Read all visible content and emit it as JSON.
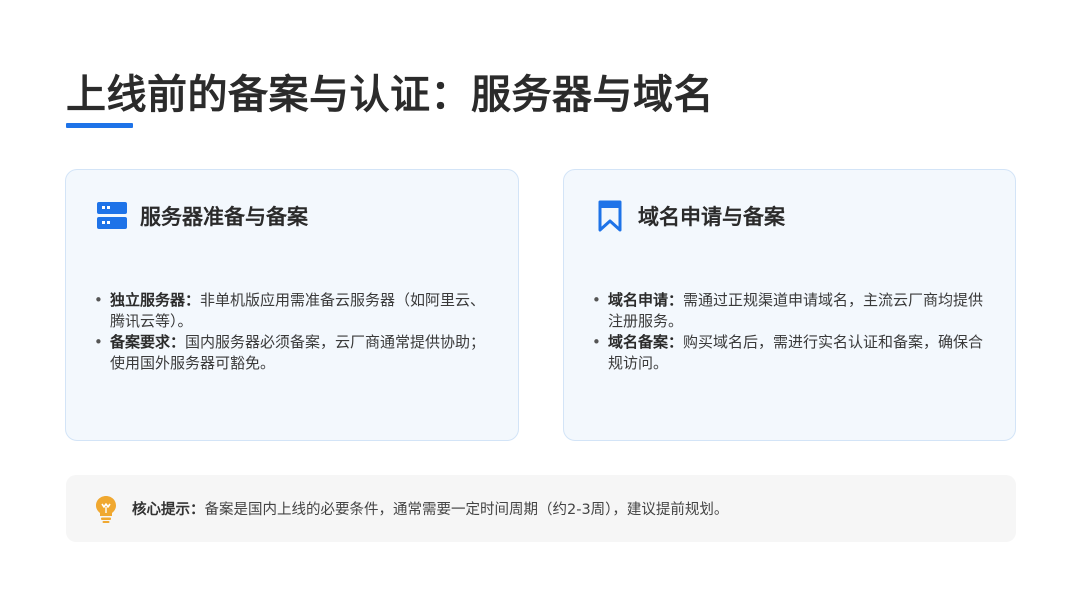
{
  "slide": {
    "title": "上线前的备案与认证：服务器与域名"
  },
  "cards": [
    {
      "icon": "server-icon",
      "title": "服务器准备与备案",
      "items": [
        {
          "key": "独立服务器：",
          "text": "非单机版应用需准备云服务器（如阿里云、腾讯云等）。"
        },
        {
          "key": "备案要求：",
          "text": "国内服务器必须备案，云厂商通常提供协助；使用国外服务器可豁免。"
        }
      ]
    },
    {
      "icon": "bookmark-icon",
      "title": "域名申请与备案",
      "items": [
        {
          "key": "域名申请：",
          "text": "需通过正规渠道申请域名，主流云厂商均提供注册服务。"
        },
        {
          "key": "域名备案：",
          "text": "购买域名后，需进行实名认证和备案，确保合规访问。"
        }
      ]
    }
  ],
  "tip": {
    "icon": "lightbulb-icon",
    "key": "核心提示：",
    "text": "备案是国内上线的必要条件，通常需要一定时间周期（约2-3周），建议提前规划。"
  },
  "colors": {
    "accent": "#1e73e8",
    "card_bg": "#f3f8fd",
    "card_border": "#d3e4f7",
    "tip_bg": "#f6f6f6",
    "tip_icon": "#f0a830"
  }
}
